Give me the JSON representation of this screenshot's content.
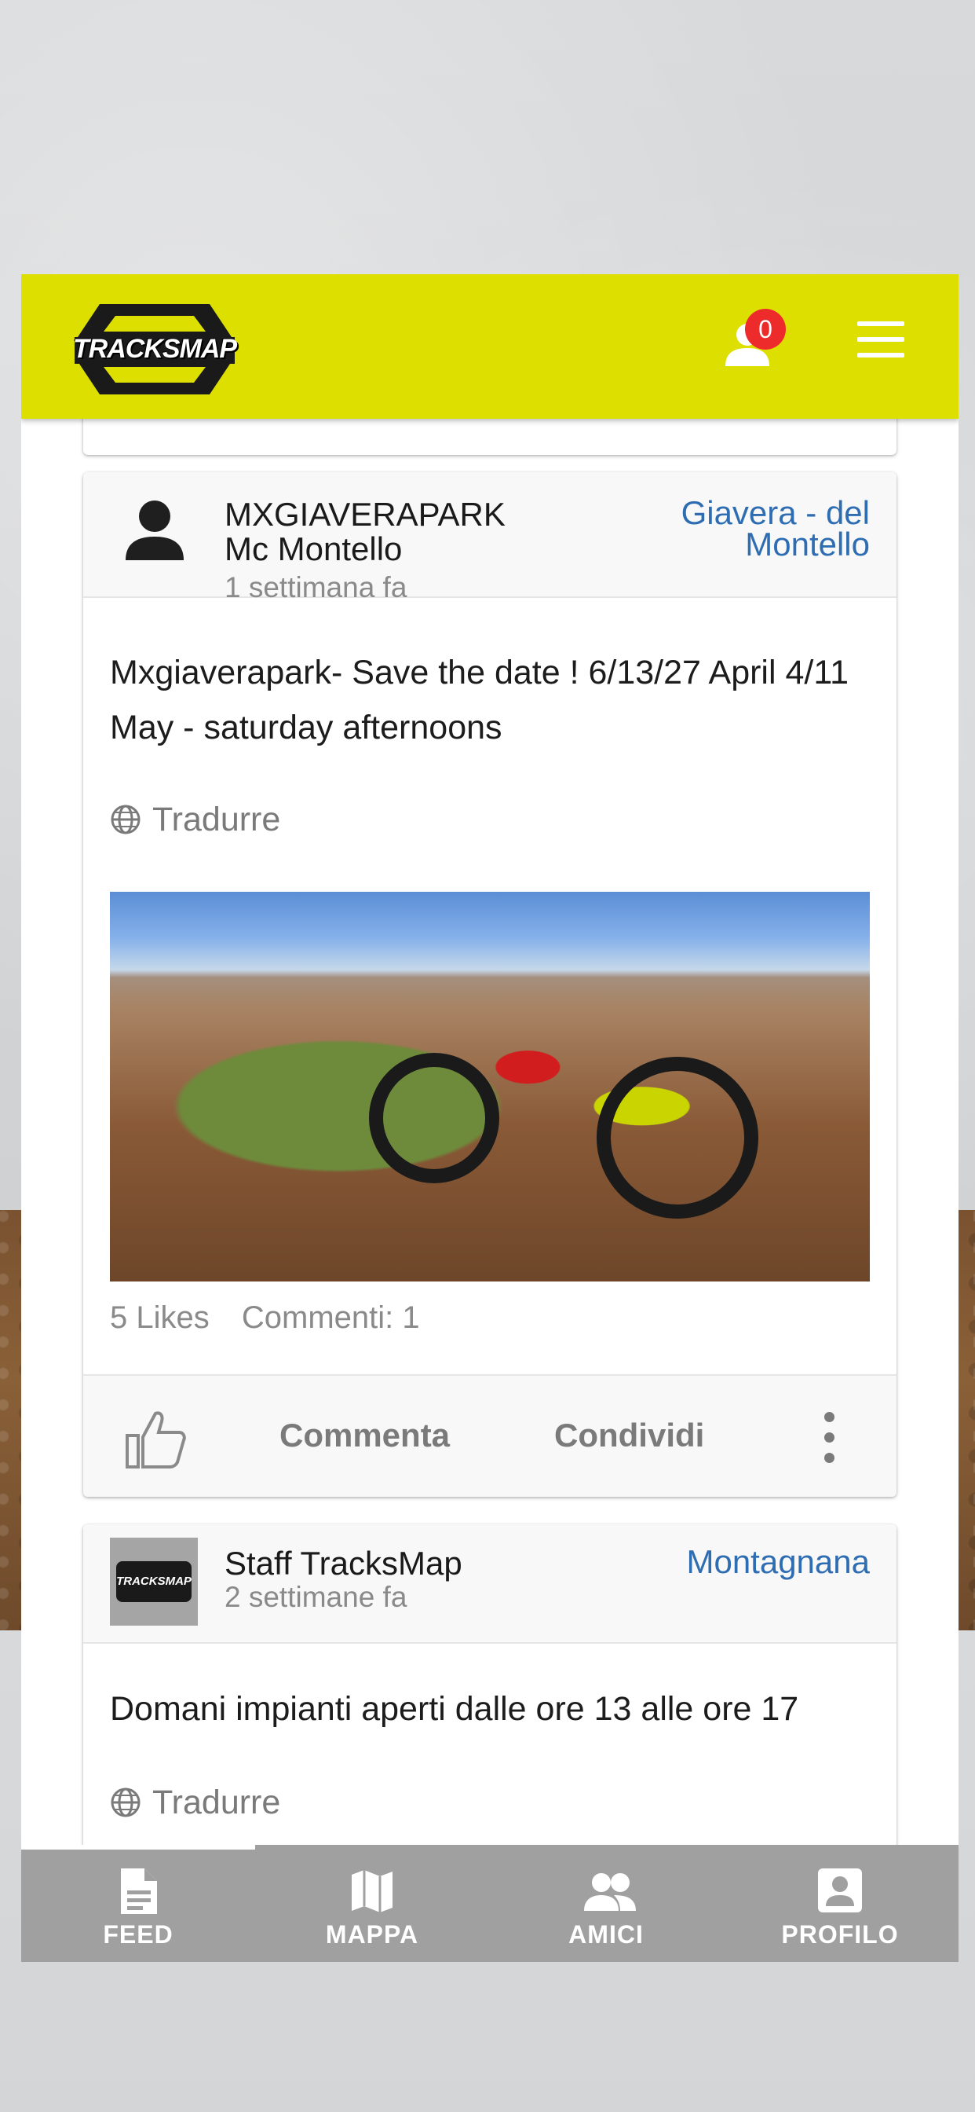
{
  "header": {
    "logo_text": "TRACKSMAP",
    "friend_requests_count": "0",
    "colors": {
      "bar": "#dcdf00",
      "badge": "#ee2b2b"
    }
  },
  "posts": [
    {
      "author_line1": "MXGIAVERAPARK",
      "author_line2": "Mc Montello",
      "time": "1 settimana fa",
      "place": "Giavera - del Montello",
      "text": "Mxgiaverapark- Save the date ! 6/13/27 April 4/11 May - saturday afternoons",
      "translate_label": "Tradurre",
      "likes": "5 Likes",
      "comments": "Commenti: 1",
      "action_comment": "Commenta",
      "action_share": "Condividi"
    },
    {
      "author": "Staff TracksMap",
      "time": "2 settimane fa",
      "place": "Montagnana",
      "text": "Domani impianti aperti dalle ore 13 alle ore 17",
      "translate_label": "Tradurre",
      "avatar_logo_text": "TRACKSMAP"
    }
  ],
  "bottom_nav": {
    "items": [
      {
        "label": "FEED",
        "icon": "document-icon",
        "active": true
      },
      {
        "label": "MAPPA",
        "icon": "map-icon",
        "active": false
      },
      {
        "label": "AMICI",
        "icon": "people-icon",
        "active": false
      },
      {
        "label": "PROFILO",
        "icon": "account-box-icon",
        "active": false
      }
    ]
  },
  "colors": {
    "link": "#2f6db3",
    "nav_bg": "#a0a0a0"
  }
}
